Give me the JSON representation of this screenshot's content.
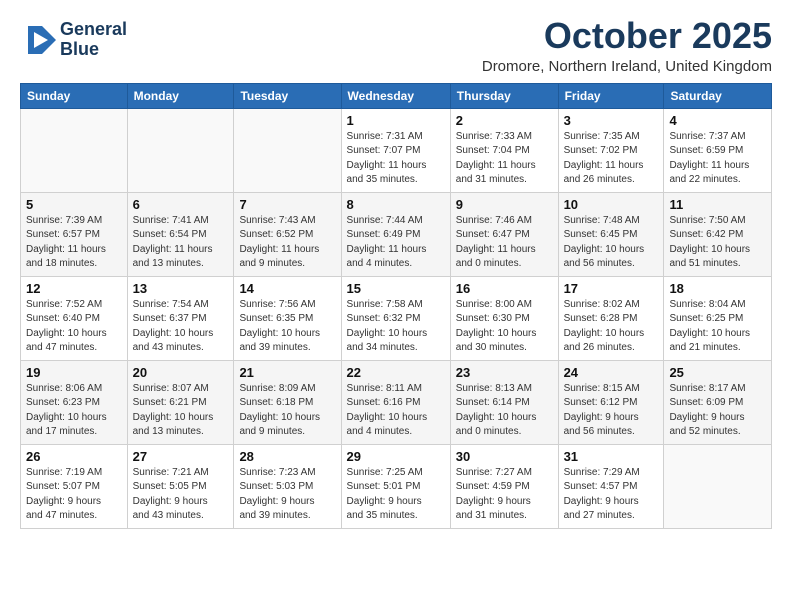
{
  "header": {
    "logo_line1": "General",
    "logo_line2": "Blue",
    "month_title": "October 2025",
    "subtitle": "Dromore, Northern Ireland, United Kingdom"
  },
  "weekdays": [
    "Sunday",
    "Monday",
    "Tuesday",
    "Wednesday",
    "Thursday",
    "Friday",
    "Saturday"
  ],
  "weeks": [
    [
      {
        "day": "",
        "info": ""
      },
      {
        "day": "",
        "info": ""
      },
      {
        "day": "",
        "info": ""
      },
      {
        "day": "1",
        "info": "Sunrise: 7:31 AM\nSunset: 7:07 PM\nDaylight: 11 hours\nand 35 minutes."
      },
      {
        "day": "2",
        "info": "Sunrise: 7:33 AM\nSunset: 7:04 PM\nDaylight: 11 hours\nand 31 minutes."
      },
      {
        "day": "3",
        "info": "Sunrise: 7:35 AM\nSunset: 7:02 PM\nDaylight: 11 hours\nand 26 minutes."
      },
      {
        "day": "4",
        "info": "Sunrise: 7:37 AM\nSunset: 6:59 PM\nDaylight: 11 hours\nand 22 minutes."
      }
    ],
    [
      {
        "day": "5",
        "info": "Sunrise: 7:39 AM\nSunset: 6:57 PM\nDaylight: 11 hours\nand 18 minutes."
      },
      {
        "day": "6",
        "info": "Sunrise: 7:41 AM\nSunset: 6:54 PM\nDaylight: 11 hours\nand 13 minutes."
      },
      {
        "day": "7",
        "info": "Sunrise: 7:43 AM\nSunset: 6:52 PM\nDaylight: 11 hours\nand 9 minutes."
      },
      {
        "day": "8",
        "info": "Sunrise: 7:44 AM\nSunset: 6:49 PM\nDaylight: 11 hours\nand 4 minutes."
      },
      {
        "day": "9",
        "info": "Sunrise: 7:46 AM\nSunset: 6:47 PM\nDaylight: 11 hours\nand 0 minutes."
      },
      {
        "day": "10",
        "info": "Sunrise: 7:48 AM\nSunset: 6:45 PM\nDaylight: 10 hours\nand 56 minutes."
      },
      {
        "day": "11",
        "info": "Sunrise: 7:50 AM\nSunset: 6:42 PM\nDaylight: 10 hours\nand 51 minutes."
      }
    ],
    [
      {
        "day": "12",
        "info": "Sunrise: 7:52 AM\nSunset: 6:40 PM\nDaylight: 10 hours\nand 47 minutes."
      },
      {
        "day": "13",
        "info": "Sunrise: 7:54 AM\nSunset: 6:37 PM\nDaylight: 10 hours\nand 43 minutes."
      },
      {
        "day": "14",
        "info": "Sunrise: 7:56 AM\nSunset: 6:35 PM\nDaylight: 10 hours\nand 39 minutes."
      },
      {
        "day": "15",
        "info": "Sunrise: 7:58 AM\nSunset: 6:32 PM\nDaylight: 10 hours\nand 34 minutes."
      },
      {
        "day": "16",
        "info": "Sunrise: 8:00 AM\nSunset: 6:30 PM\nDaylight: 10 hours\nand 30 minutes."
      },
      {
        "day": "17",
        "info": "Sunrise: 8:02 AM\nSunset: 6:28 PM\nDaylight: 10 hours\nand 26 minutes."
      },
      {
        "day": "18",
        "info": "Sunrise: 8:04 AM\nSunset: 6:25 PM\nDaylight: 10 hours\nand 21 minutes."
      }
    ],
    [
      {
        "day": "19",
        "info": "Sunrise: 8:06 AM\nSunset: 6:23 PM\nDaylight: 10 hours\nand 17 minutes."
      },
      {
        "day": "20",
        "info": "Sunrise: 8:07 AM\nSunset: 6:21 PM\nDaylight: 10 hours\nand 13 minutes."
      },
      {
        "day": "21",
        "info": "Sunrise: 8:09 AM\nSunset: 6:18 PM\nDaylight: 10 hours\nand 9 minutes."
      },
      {
        "day": "22",
        "info": "Sunrise: 8:11 AM\nSunset: 6:16 PM\nDaylight: 10 hours\nand 4 minutes."
      },
      {
        "day": "23",
        "info": "Sunrise: 8:13 AM\nSunset: 6:14 PM\nDaylight: 10 hours\nand 0 minutes."
      },
      {
        "day": "24",
        "info": "Sunrise: 8:15 AM\nSunset: 6:12 PM\nDaylight: 9 hours\nand 56 minutes."
      },
      {
        "day": "25",
        "info": "Sunrise: 8:17 AM\nSunset: 6:09 PM\nDaylight: 9 hours\nand 52 minutes."
      }
    ],
    [
      {
        "day": "26",
        "info": "Sunrise: 7:19 AM\nSunset: 5:07 PM\nDaylight: 9 hours\nand 47 minutes."
      },
      {
        "day": "27",
        "info": "Sunrise: 7:21 AM\nSunset: 5:05 PM\nDaylight: 9 hours\nand 43 minutes."
      },
      {
        "day": "28",
        "info": "Sunrise: 7:23 AM\nSunset: 5:03 PM\nDaylight: 9 hours\nand 39 minutes."
      },
      {
        "day": "29",
        "info": "Sunrise: 7:25 AM\nSunset: 5:01 PM\nDaylight: 9 hours\nand 35 minutes."
      },
      {
        "day": "30",
        "info": "Sunrise: 7:27 AM\nSunset: 4:59 PM\nDaylight: 9 hours\nand 31 minutes."
      },
      {
        "day": "31",
        "info": "Sunrise: 7:29 AM\nSunset: 4:57 PM\nDaylight: 9 hours\nand 27 minutes."
      },
      {
        "day": "",
        "info": ""
      }
    ]
  ]
}
